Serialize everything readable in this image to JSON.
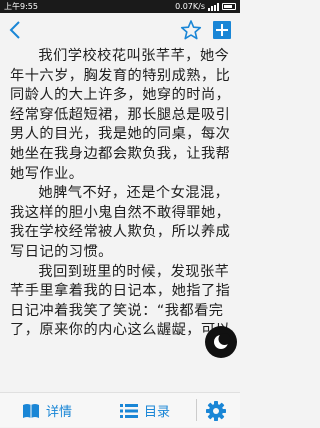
{
  "status_bar": {
    "time": "上午9:55",
    "network_speed": "0.07K/s",
    "battery_level": 0.8
  },
  "content": {
    "paragraphs": [
      "我们学校校花叫张芊芊，她今年十六岁，胸发育的特别成熟，比同龄人的大上许多，她穿的时尚，经常穿低超短裙，那长腿总是吸引男人的目光，我是她的同桌，每次她坐在我身边都会欺负我，让我帮她写作业。",
      "她脾气不好，还是个女混混，我这样的胆小鬼自然不敢得罪她，我在学校经常被人欺负，所以养成写日记的习惯。",
      "我回到班里的时候，发现张芊芊手里拿着我的日记本，她指了指日记冲着我笑了笑说：“我都看完了，原来你的内心这么龌龊，可以"
    ]
  },
  "bottom_bar": {
    "details_label": "详情",
    "toc_label": "目录"
  },
  "icons": {
    "back": "back-arrow-icon",
    "star": "star-icon",
    "add_bookshelf": "add-box-icon",
    "details": "book-icon",
    "toc": "list-icon",
    "settings": "gear-icon",
    "night_mode": "moon-icon"
  },
  "colors": {
    "accent": "#1a86d6",
    "background": "#f3f3f3",
    "statusbar": "#1a1a1a"
  }
}
